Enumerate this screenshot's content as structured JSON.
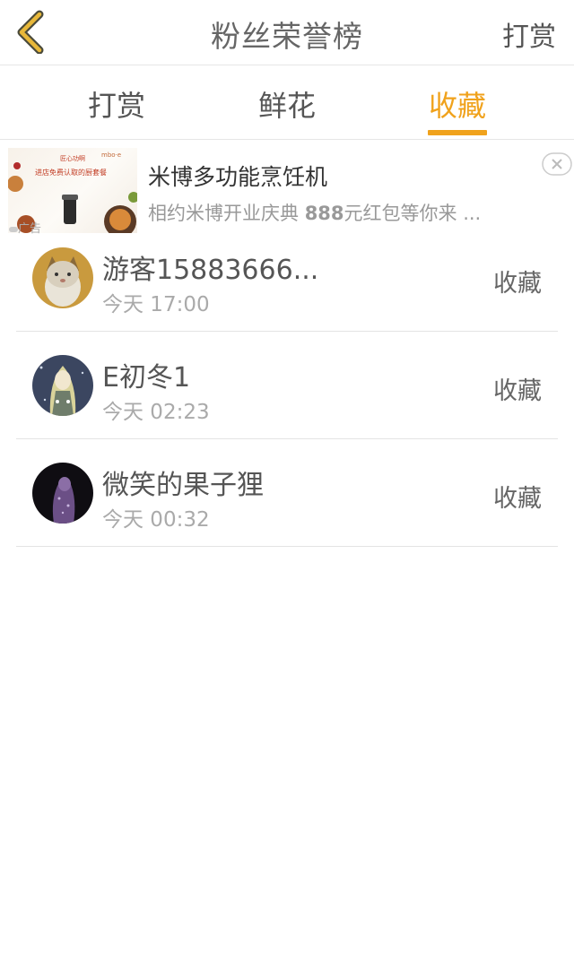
{
  "header": {
    "title": "粉丝荣誉榜",
    "action_label": "打赏",
    "accent_color": "#f0a21c"
  },
  "tabs": [
    {
      "label": "打赏",
      "active": false
    },
    {
      "label": "鲜花",
      "active": false
    },
    {
      "label": "收藏",
      "active": true
    }
  ],
  "ad": {
    "title": "米博多功能烹饪机",
    "desc_prefix": "相约米博开业庆典 ",
    "desc_bold": "888",
    "desc_suffix": "元红包等你来 ...",
    "badge": "广告",
    "image_text": {
      "brand": "mbo·e",
      "line1": "匠心功啊",
      "line2": "进店免费认取的厨套餐"
    }
  },
  "items": [
    {
      "name": "游客15883666...",
      "time": "今天 17:00",
      "action": "收藏",
      "avatar": "cat-avatar"
    },
    {
      "name": "E初冬1",
      "time": "今天 02:23",
      "action": "收藏",
      "avatar": "anime-girl-avatar"
    },
    {
      "name": "微笑的果子狸",
      "time": "今天 00:32",
      "action": "收藏",
      "avatar": "purple-figure-avatar"
    }
  ]
}
